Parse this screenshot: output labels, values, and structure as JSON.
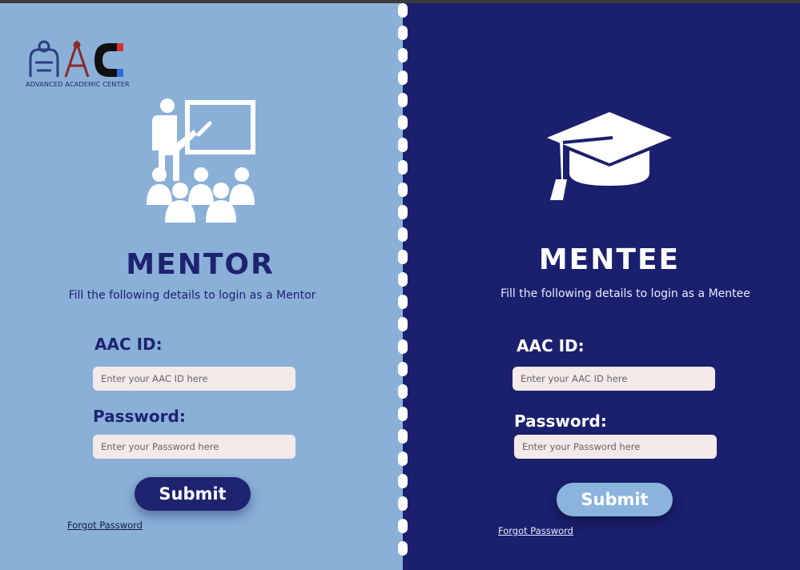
{
  "logo": {
    "subtext": "ADVANCED ACADEMIC CENTER"
  },
  "mentor": {
    "title": "MENTOR",
    "subtitle": "Fill the following details to login as a Mentor",
    "id_label": "AAC ID:",
    "id_placeholder": "Enter your AAC ID here",
    "password_label": "Password:",
    "password_placeholder": "Enter your Password here",
    "submit_label": "Submit",
    "forgot_label": "Forgot Password"
  },
  "mentee": {
    "title": "MENTEE",
    "subtitle": "Fill the following details to login as a Mentee",
    "id_label": "AAC ID:",
    "id_placeholder": "Enter your AAC ID here",
    "password_label": "Password:",
    "password_placeholder": "Enter your Password here",
    "submit_label": "Submit",
    "forgot_label": "Forgot Password"
  },
  "colors": {
    "mentor_bg": "#8ab0d8",
    "mentee_bg": "#1a1f6e",
    "mentor_button": "#1e2370",
    "mentee_button": "#8ab4dc",
    "input_bg": "#f2e9e8"
  }
}
